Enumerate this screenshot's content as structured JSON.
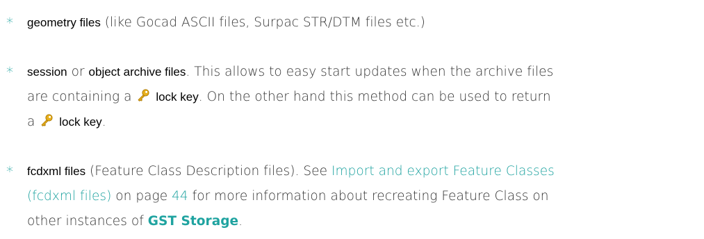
{
  "items": [
    {
      "term": "geometry files",
      "text_after": "(like Gocad ASCII files, Surpac STR/DTM files etc.)"
    },
    {
      "term": "session",
      "text_or": " or ",
      "term2": "object archive files",
      "text_line1_rest": ". This allows to easy start updates when the archive files",
      "text_line2_a": "are containing a",
      "lock_key_label": "lock key",
      "text_line2_b": ". On the other hand this method can be used to return",
      "text_line3_a": "a",
      "lock_key_label2": "lock key",
      "text_line3_b": "."
    },
    {
      "term": "fcdxml files",
      "text_line1_a": "(Feature Class Description files). See",
      "link_line1": "Import and export Feature Classes",
      "link_line2": "(fcdxml files)",
      "text_on_page": " on page ",
      "page_number": "44",
      "text_line2_rest": " for more information about recreating Feature Class on",
      "text_line3_a": "other instances of ",
      "product_name": "GST Storage",
      "text_line3_b": "."
    }
  ],
  "bullet_glyph": "*",
  "colors": {
    "accent": "#1fa3a0",
    "body_text": "#333333",
    "term_text": "#000000",
    "key_icon": "#e8b01c"
  },
  "icons": [
    "key-icon"
  ]
}
